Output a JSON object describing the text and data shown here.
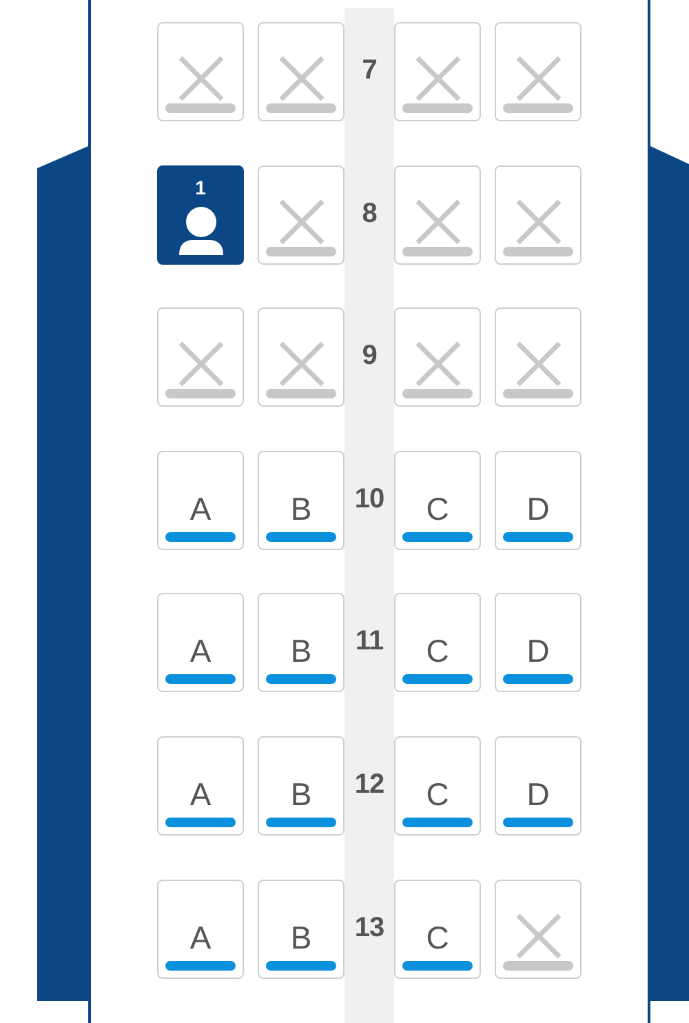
{
  "rows": [
    {
      "number": "7",
      "seats": [
        {
          "kind": "unavailable"
        },
        {
          "kind": "unavailable"
        },
        {
          "kind": "unavailable"
        },
        {
          "kind": "unavailable"
        }
      ]
    },
    {
      "number": "8",
      "seats": [
        {
          "kind": "occupied",
          "label": "1"
        },
        {
          "kind": "unavailable"
        },
        {
          "kind": "unavailable"
        },
        {
          "kind": "unavailable"
        }
      ]
    },
    {
      "number": "9",
      "seats": [
        {
          "kind": "unavailable"
        },
        {
          "kind": "unavailable"
        },
        {
          "kind": "unavailable"
        },
        {
          "kind": "unavailable"
        }
      ]
    },
    {
      "number": "10",
      "seats": [
        {
          "kind": "available",
          "label": "A"
        },
        {
          "kind": "available",
          "label": "B"
        },
        {
          "kind": "available",
          "label": "C"
        },
        {
          "kind": "available",
          "label": "D"
        }
      ]
    },
    {
      "number": "11",
      "seats": [
        {
          "kind": "available",
          "label": "A"
        },
        {
          "kind": "available",
          "label": "B"
        },
        {
          "kind": "available",
          "label": "C"
        },
        {
          "kind": "available",
          "label": "D"
        }
      ]
    },
    {
      "number": "12",
      "seats": [
        {
          "kind": "available",
          "label": "A"
        },
        {
          "kind": "available",
          "label": "B"
        },
        {
          "kind": "available",
          "label": "C"
        },
        {
          "kind": "available",
          "label": "D"
        }
      ]
    },
    {
      "number": "13",
      "seats": [
        {
          "kind": "available",
          "label": "A"
        },
        {
          "kind": "available",
          "label": "B"
        },
        {
          "kind": "available",
          "label": "C"
        },
        {
          "kind": "unavailable"
        }
      ]
    }
  ]
}
